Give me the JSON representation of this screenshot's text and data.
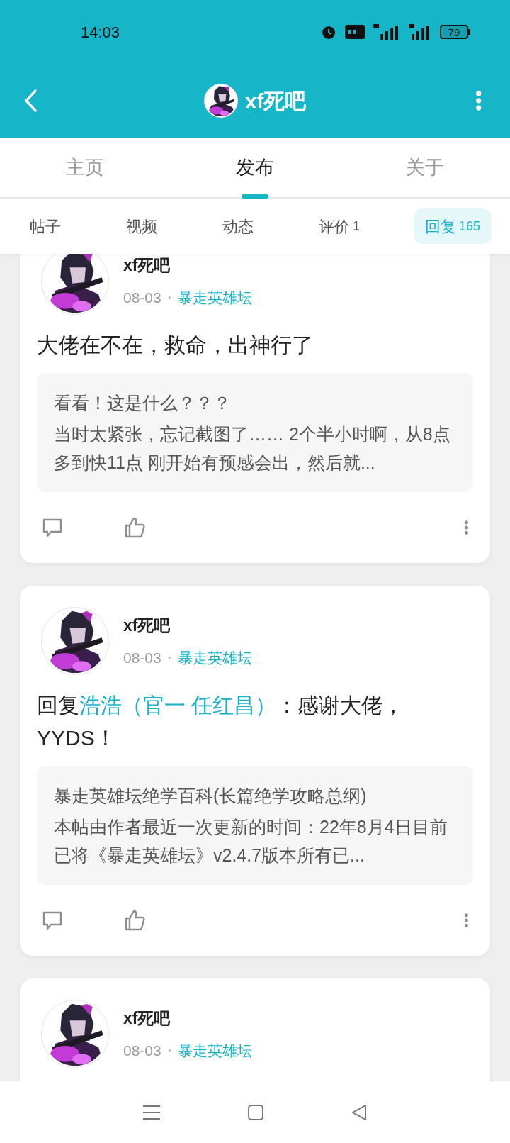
{
  "status_bar": {
    "time": "14:03",
    "battery": "79"
  },
  "header": {
    "title": "xf死吧"
  },
  "tabs": [
    {
      "label": "主页",
      "selected": false
    },
    {
      "label": "发布",
      "selected": true
    },
    {
      "label": "关于",
      "selected": false
    }
  ],
  "subtabs": [
    {
      "label": "帖子",
      "selected": false
    },
    {
      "label": "视频",
      "selected": false
    },
    {
      "label": "动态",
      "selected": false
    },
    {
      "label": "评价",
      "count": "1",
      "selected": false
    },
    {
      "label": "回复",
      "count": "165",
      "selected": true
    }
  ],
  "posts": [
    {
      "author": "xf死吧",
      "date": "08-03",
      "forum": "暴走英雄坛",
      "content": [
        {
          "kind": "text",
          "text": "大佬在不在，救命，出神行了"
        }
      ],
      "quote_title": "看看！这是什么？？？",
      "quote_body": "当时太紧张，忘记截图了…… 2个半小时啊，从8点多到快11点 刚开始有预感会出，然后就..."
    },
    {
      "author": "xf死吧",
      "date": "08-03",
      "forum": "暴走英雄坛",
      "content": [
        {
          "kind": "text",
          "text": "回复"
        },
        {
          "kind": "mention",
          "text": "浩浩（官一 任红昌）"
        },
        {
          "kind": "text",
          "text": "：感谢大佬，YYDS！"
        }
      ],
      "quote_title": "暴走英雄坛绝学百科(长篇绝学攻略总纲)",
      "quote_body": "本帖由作者最近一次更新的时间：22年8月4日目前已将《暴走英雄坛》v2.4.7版本所有已..."
    },
    {
      "author": "xf死吧",
      "date": "08-03",
      "forum": "暴走英雄坛"
    }
  ]
}
